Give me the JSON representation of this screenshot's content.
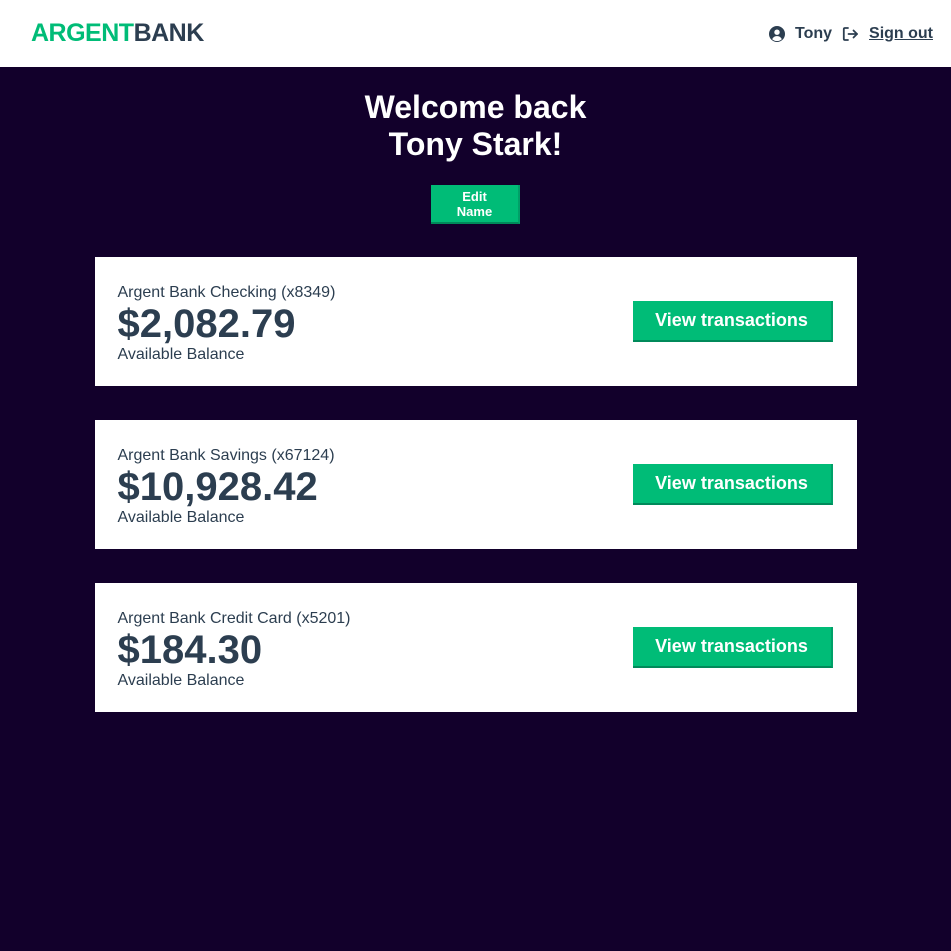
{
  "brand": {
    "part1": "ARGENT",
    "part2": "BANK"
  },
  "nav": {
    "user_icon": "user-circle-icon",
    "user_name": "Tony",
    "signout_icon": "sign-out-icon",
    "signout_label": "Sign out"
  },
  "header": {
    "line1": "Welcome back",
    "line2": "Tony Stark!",
    "edit_label": "Edit Name"
  },
  "accounts": [
    {
      "title": "Argent Bank Checking (x8349)",
      "amount": "$2,082.79",
      "description": "Available Balance",
      "button": "View transactions"
    },
    {
      "title": "Argent Bank Savings (x67124)",
      "amount": "$10,928.42",
      "description": "Available Balance",
      "button": "View transactions"
    },
    {
      "title": "Argent Bank Credit Card (x5201)",
      "amount": "$184.30",
      "description": "Available Balance",
      "button": "View transactions"
    }
  ],
  "colors": {
    "accent": "#00bc77",
    "background": "#12002b",
    "text": "#2c3e50",
    "card": "#ffffff"
  }
}
